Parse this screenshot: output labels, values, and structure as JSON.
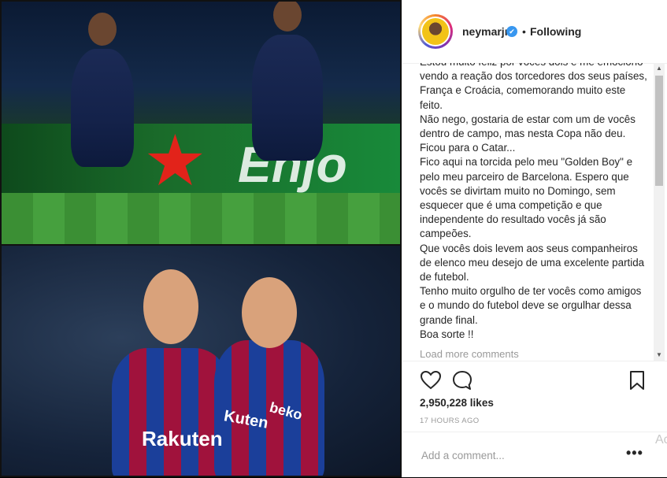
{
  "header": {
    "username": "neymarjr",
    "verified_glyph": "✔",
    "separator": "•",
    "follow_status": "Following"
  },
  "photo": {
    "top": {
      "ad_word": "Enjo"
    },
    "bottom": {
      "sponsor_left": "Rakuten",
      "sponsor_right": "beko",
      "sponsor_mid": "Kuten"
    }
  },
  "caption": {
    "text": "Estou muito feliz por vocês dois e me emociono vendo a reação dos torcedores dos seus países, França e Croácia, comemorando muito este feito.\nNão nego, gostaria de estar com um de vocês dentro de campo, mas nesta Copa não deu. Ficou para o Catar...\nFico aqui na torcida pelo meu \"Golden Boy\" e pelo meu parceiro de Barcelona. Espero que vocês se divirtam muito no Domingo, sem esquecer que é uma competição e que independente do resultado vocês já são campeões.\nQue vocês dois levem aos seus companheiros de elenco meu desejo de uma excelente partida de futebol.\nTenho muito orgulho de ter vocês como amigos e o mundo do futebol deve se orgulhar dessa grande final.\nBoa sorte !!",
    "load_more": "Load more comments"
  },
  "actions": {
    "likes": "2,950,228 likes",
    "timestamp": "17 HOURS AGO",
    "icons": [
      "heart-icon",
      "comment-icon",
      "bookmark-icon"
    ]
  },
  "comment": {
    "placeholder": "Add a comment...",
    "more_glyph": "•••"
  },
  "watermark": {
    "text": "Ac"
  },
  "colors": {
    "verified": "#3897f0",
    "text": "#262626",
    "muted": "#999999",
    "border": "#efefef"
  }
}
